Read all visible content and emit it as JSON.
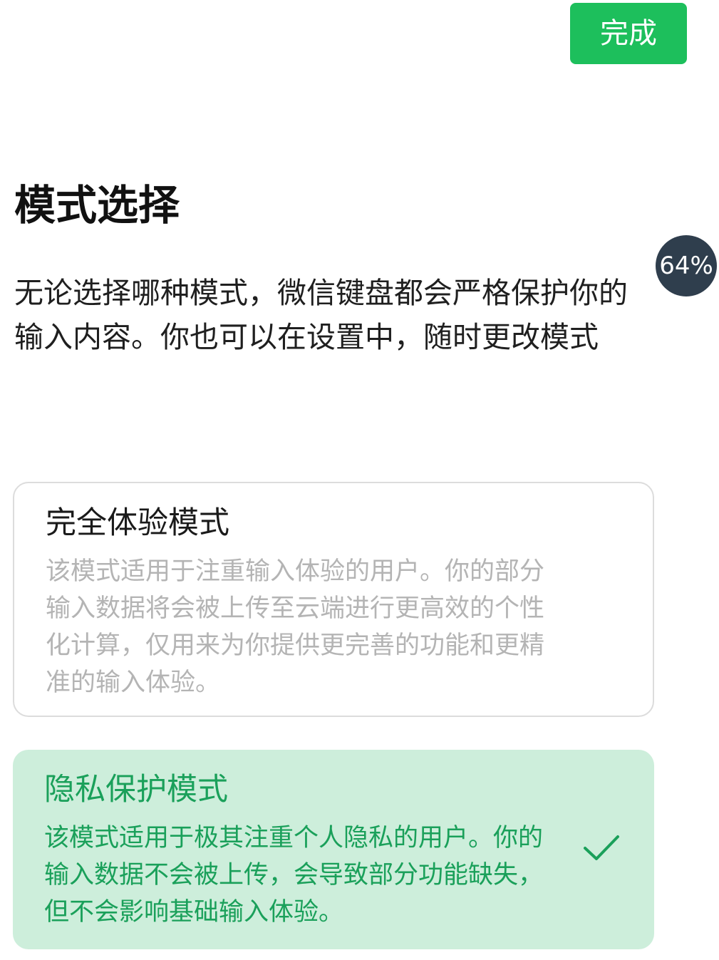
{
  "header": {
    "done_label": "完成"
  },
  "page": {
    "title": "模式选择",
    "progress_badge": "64%",
    "description": "无论选择哪种模式，微信键盘都会严格保护你的输入内容。你也可以在设置中，随时更改模式"
  },
  "modes": [
    {
      "title": "完全体验模式",
      "description": "该模式适用于注重输入体验的用户。你的部分输入数据将会被上传至云端进行更高效的个性化计算，仅用来为你提供更完善的功能和更精准的输入体验。",
      "selected": false
    },
    {
      "title": "隐私保护模式",
      "description": "该模式适用于极其注重个人隐私的用户。你的输入数据不会被上传，会导致部分功能缺失，但不会影响基础输入体验。",
      "selected": true,
      "selected_icon": "checkmark-icon"
    }
  ],
  "colors": {
    "accent": "#1dbf5c",
    "accent_text": "#1aa05a",
    "selected_card_bg": "#cdeedb",
    "badge_bg": "#2f3e4d",
    "muted_text": "#b4b4b4"
  }
}
